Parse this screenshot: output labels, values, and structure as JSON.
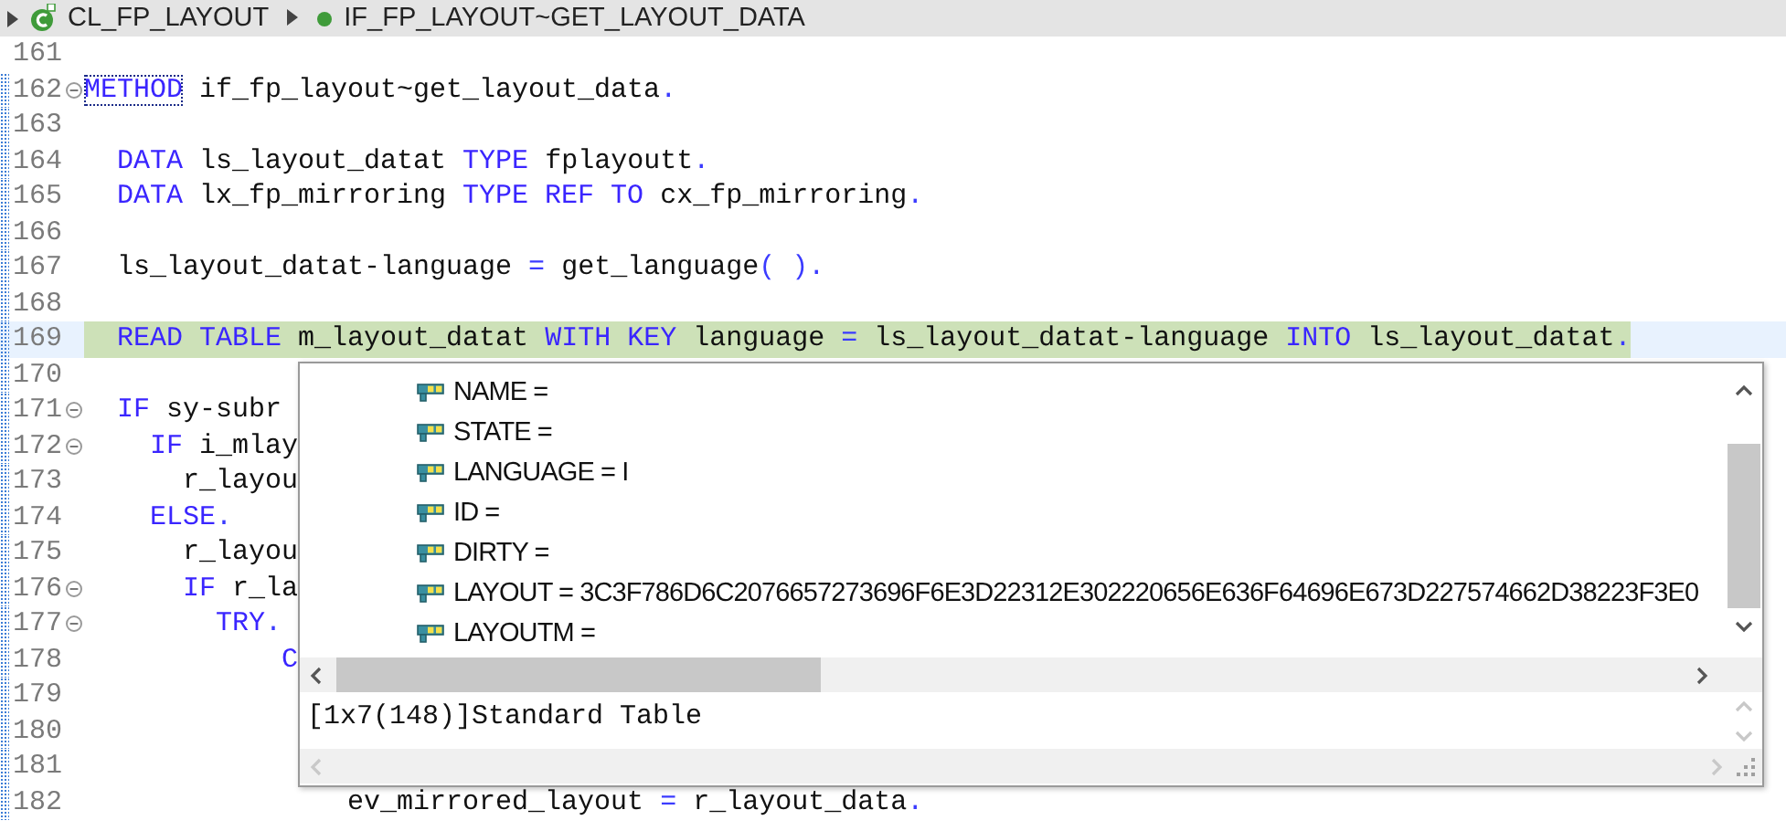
{
  "breadcrumb": [
    {
      "label": "CL_FP_LAYOUT",
      "kind": "class"
    },
    {
      "label": "IF_FP_LAYOUT~GET_LAYOUT_DATA",
      "kind": "method"
    }
  ],
  "editor": {
    "lines": [
      {
        "number": "161",
        "changed": false,
        "foldable": false,
        "highlighted": false
      },
      {
        "number": "162",
        "changed": true,
        "foldable": true,
        "highlighted": false,
        "tokens": [
          {
            "text": "METHOD",
            "kind": "keyword",
            "boxed": true
          },
          {
            "text": " if_fp_layout~get_layout_data",
            "kind": "plain"
          },
          {
            "text": ".",
            "kind": "symbol"
          }
        ]
      },
      {
        "number": "163",
        "changed": true,
        "foldable": false,
        "highlighted": false
      },
      {
        "number": "164",
        "changed": true,
        "foldable": false,
        "highlighted": false,
        "tokens": [
          {
            "text": "  DATA",
            "kind": "keyword"
          },
          {
            "text": " ls_layout_datat ",
            "kind": "plain"
          },
          {
            "text": "TYPE",
            "kind": "keyword"
          },
          {
            "text": " fplayoutt",
            "kind": "plain"
          },
          {
            "text": ".",
            "kind": "symbol"
          }
        ]
      },
      {
        "number": "165",
        "changed": true,
        "foldable": false,
        "highlighted": false,
        "tokens": [
          {
            "text": "  DATA",
            "kind": "keyword"
          },
          {
            "text": " lx_fp_mirroring ",
            "kind": "plain"
          },
          {
            "text": "TYPE REF TO",
            "kind": "keyword"
          },
          {
            "text": " cx_fp_mirroring",
            "kind": "plain"
          },
          {
            "text": ".",
            "kind": "symbol"
          }
        ]
      },
      {
        "number": "166",
        "changed": true,
        "foldable": false,
        "highlighted": false
      },
      {
        "number": "167",
        "changed": true,
        "foldable": false,
        "highlighted": false,
        "tokens": [
          {
            "text": "  ls_layout_datat-language ",
            "kind": "plain"
          },
          {
            "text": "=",
            "kind": "symbol"
          },
          {
            "text": " get_language",
            "kind": "plain"
          },
          {
            "text": "( )",
            "kind": "symbol"
          },
          {
            "text": ".",
            "kind": "symbol"
          }
        ]
      },
      {
        "number": "168",
        "changed": true,
        "foldable": false,
        "highlighted": false
      },
      {
        "number": "169",
        "changed": true,
        "foldable": false,
        "highlighted": true,
        "tokens": [
          {
            "text": "  READ TABLE",
            "kind": "keyword"
          },
          {
            "text": " m_layout_datat ",
            "kind": "plain"
          },
          {
            "text": "WITH KEY",
            "kind": "keyword"
          },
          {
            "text": " language ",
            "kind": "plain"
          },
          {
            "text": "=",
            "kind": "symbol"
          },
          {
            "text": " ls_layout_datat-language ",
            "kind": "plain"
          },
          {
            "text": "INTO",
            "kind": "keyword"
          },
          {
            "text": " ls_layout_datat",
            "kind": "plain"
          },
          {
            "text": ".",
            "kind": "symbol"
          }
        ]
      },
      {
        "number": "170",
        "changed": true,
        "foldable": false,
        "highlighted": false
      },
      {
        "number": "171",
        "changed": true,
        "foldable": true,
        "highlighted": false,
        "tokens": [
          {
            "text": "  IF",
            "kind": "keyword"
          },
          {
            "text": " sy-subr",
            "kind": "plain"
          }
        ]
      },
      {
        "number": "172",
        "changed": true,
        "foldable": true,
        "highlighted": false,
        "tokens": [
          {
            "text": "    IF",
            "kind": "keyword"
          },
          {
            "text": " i_mlay",
            "kind": "plain"
          }
        ]
      },
      {
        "number": "173",
        "changed": true,
        "foldable": false,
        "highlighted": false,
        "tokens": [
          {
            "text": "      r_layou",
            "kind": "plain"
          }
        ]
      },
      {
        "number": "174",
        "changed": true,
        "foldable": false,
        "highlighted": false,
        "tokens": [
          {
            "text": "    ELSE",
            "kind": "keyword"
          },
          {
            "text": ".",
            "kind": "symbol"
          }
        ]
      },
      {
        "number": "175",
        "changed": true,
        "foldable": false,
        "highlighted": false,
        "tokens": [
          {
            "text": "      r_layou",
            "kind": "plain"
          }
        ]
      },
      {
        "number": "176",
        "changed": true,
        "foldable": true,
        "highlighted": false,
        "tokens": [
          {
            "text": "      IF",
            "kind": "keyword"
          },
          {
            "text": " r_la",
            "kind": "plain"
          }
        ]
      },
      {
        "number": "177",
        "changed": true,
        "foldable": true,
        "highlighted": false,
        "tokens": [
          {
            "text": "        TRY",
            "kind": "keyword"
          },
          {
            "text": ".",
            "kind": "symbol"
          }
        ]
      },
      {
        "number": "178",
        "changed": true,
        "foldable": false,
        "highlighted": false,
        "tokens": [
          {
            "text": "            C",
            "kind": "keyword"
          }
        ]
      },
      {
        "number": "179",
        "changed": true,
        "foldable": false,
        "highlighted": false
      },
      {
        "number": "180",
        "changed": true,
        "foldable": false,
        "highlighted": false
      },
      {
        "number": "181",
        "changed": true,
        "foldable": false,
        "highlighted": false
      },
      {
        "number": "182",
        "changed": true,
        "foldable": false,
        "highlighted": false,
        "tokens": [
          {
            "text": "                ev_mirrored_layout ",
            "kind": "plain"
          },
          {
            "text": "=",
            "kind": "symbol"
          },
          {
            "text": " r_layout_data",
            "kind": "plain"
          },
          {
            "text": ".",
            "kind": "symbol"
          }
        ]
      }
    ]
  },
  "popup": {
    "items": [
      {
        "label": "NAME ="
      },
      {
        "label": "STATE ="
      },
      {
        "label": "LANGUAGE = I"
      },
      {
        "label": "ID ="
      },
      {
        "label": "DIRTY ="
      },
      {
        "label": "LAYOUT = 3C3F786D6C2076657273696F6E3D22312E302220656E636F64696E673D227574662D38223F3E0"
      },
      {
        "label": "LAYOUTM ="
      }
    ],
    "summary": "[1x7(148)]Standard Table"
  }
}
